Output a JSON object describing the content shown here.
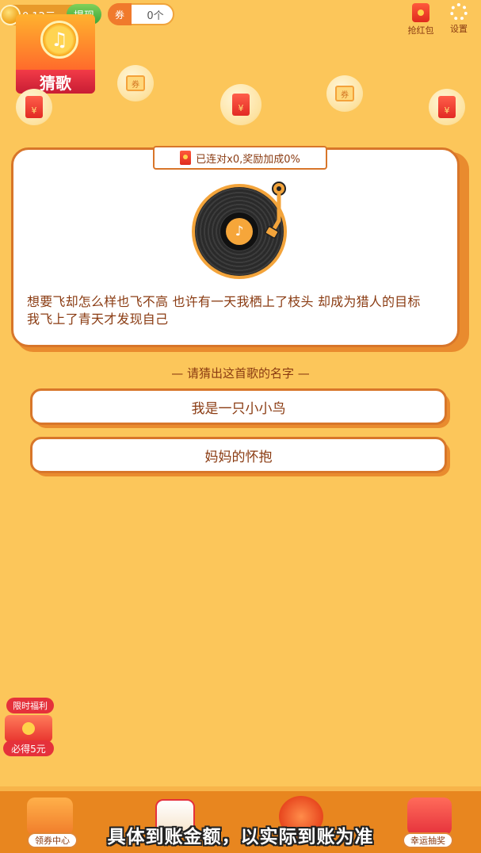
{
  "header": {
    "coin_balance": "0.12元",
    "withdraw_label": "提现",
    "ticket_icon_label": "券",
    "ticket_count": "0个",
    "redpack_label": "抢红包",
    "settings_label": "设置"
  },
  "logo": {
    "title": "猜歌"
  },
  "floating": {
    "redpack_symbol": "¥",
    "ticket_symbol": "券"
  },
  "card": {
    "streak_text": "已连对x0,奖励加成0%",
    "lyrics_line1": "想要飞却怎么样也飞不高 也许有一天我栖上了枝头 却成为猎人的目标",
    "lyrics_line2": "我飞上了青天才发现自己"
  },
  "prompt": {
    "text": "— 请猜出这首歌的名字 —"
  },
  "options": [
    {
      "label": "我是一只小小鸟"
    },
    {
      "label": "妈妈的怀抱"
    }
  ],
  "promo": {
    "tag": "限时福利",
    "label": "必得5元"
  },
  "bottom_nav": {
    "items": [
      {
        "label": "领券中心"
      },
      {
        "label": "幸运抽奖"
      }
    ]
  },
  "caption": "具体到账金额，以实际到账为准",
  "colors": {
    "background": "#fcc65a",
    "accent_orange": "#e98b2e",
    "text_brown": "#8a3b12",
    "red": "#e5313b"
  }
}
